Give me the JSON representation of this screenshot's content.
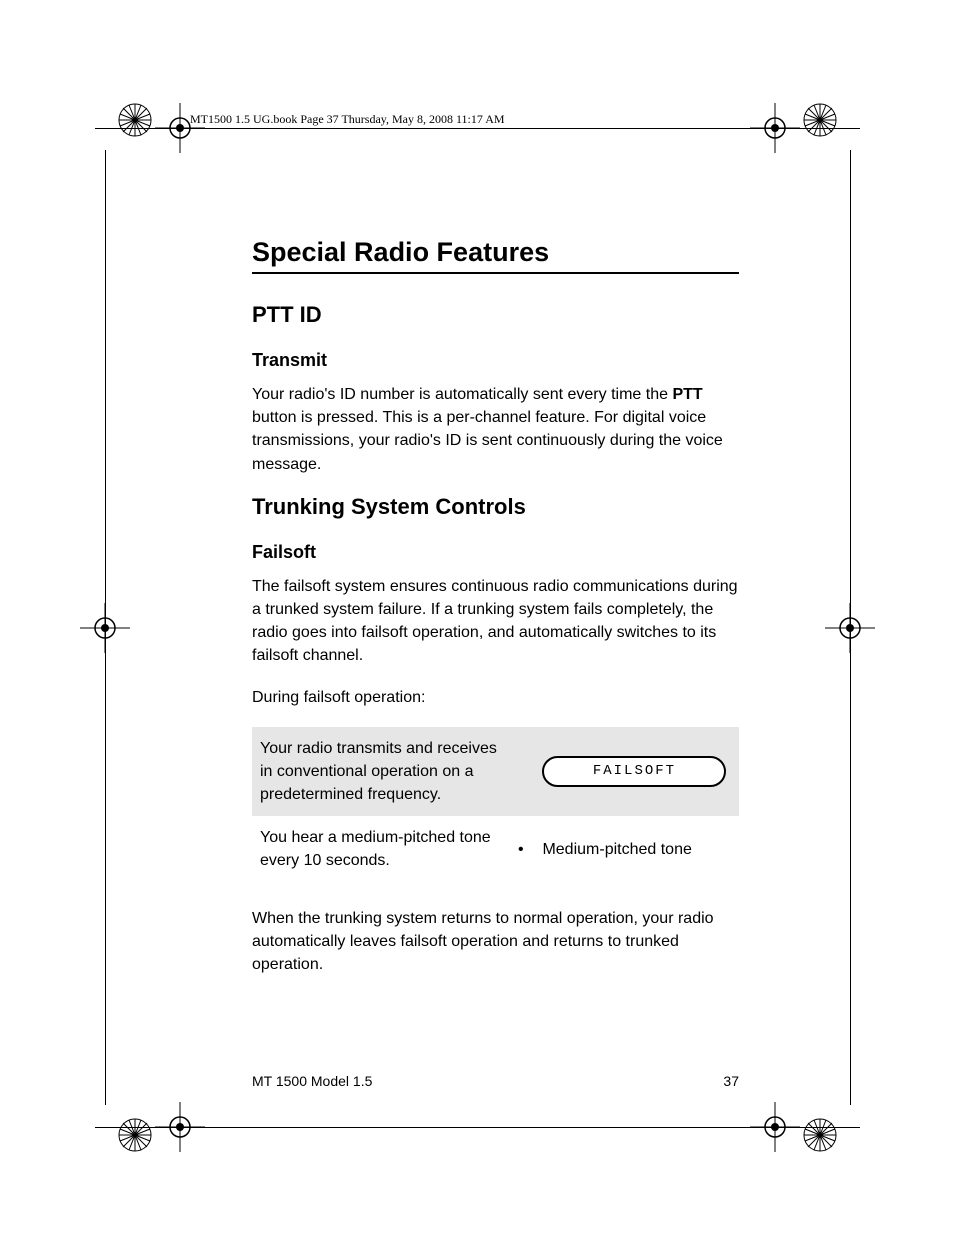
{
  "header_label": "MT1500 1.5 UG.book  Page 37  Thursday, May 8, 2008   11:17 AM",
  "title": "Special Radio Features",
  "section1": {
    "heading": "PTT ID",
    "sub": "Transmit",
    "para_pre": "Your radio's ID number is automatically sent every time the ",
    "ptt": "PTT",
    "para_post": " button is pressed. This is a per-channel feature. For digital voice transmissions, your radio's ID is sent continuously during the voice message."
  },
  "section2": {
    "heading": "Trunking System Controls",
    "sub": "Failsoft",
    "para1": "The failsoft system ensures continuous radio communications during a trunked system failure. If a trunking system fails completely, the radio goes into failsoft operation, and automatically switches to its failsoft channel.",
    "para2": "During failsoft operation:",
    "row1_left": "Your radio transmits and receives in conventional operation on a predetermined frequency.",
    "row1_lcd": "FAILSOFT",
    "row2_left": "You hear a medium-pitched tone every 10 seconds.",
    "row2_right": "Medium-pitched tone",
    "para3": "When the trunking system returns to normal operation, your radio automatically leaves failsoft operation and returns to trunked operation."
  },
  "footer": {
    "model": "MT 1500 Model 1.5",
    "page": "37"
  }
}
